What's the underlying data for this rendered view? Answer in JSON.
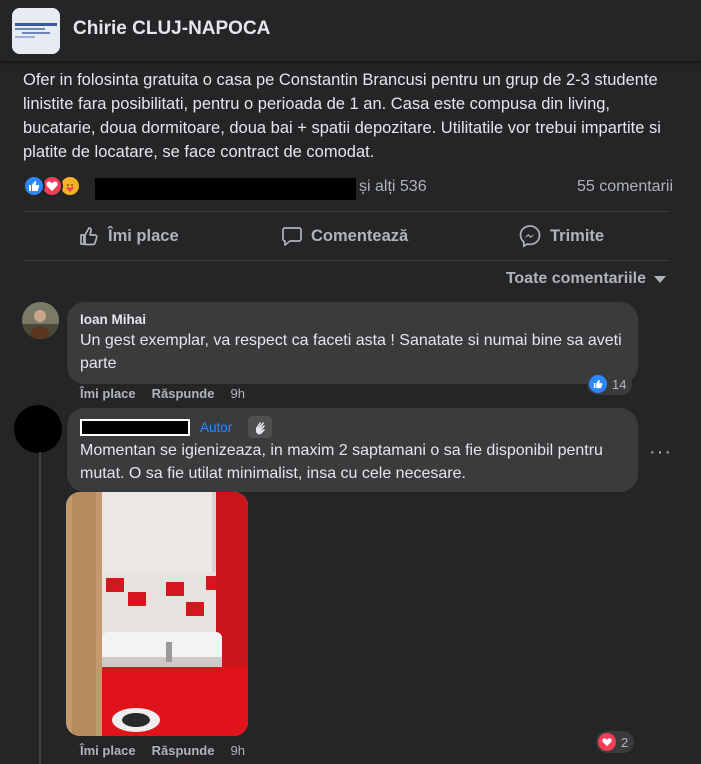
{
  "group": {
    "name": "Chirie CLUJ-NAPOCA"
  },
  "post": {
    "text": "Ofer in folosinta gratuita o casa pe Constantin Brancusi pentru un grup de 2-3 studente linistite fara posibilitati, pentru o perioada de 1 an. Casa este compusa din living, bucatarie, doua dormitoare, doua bai + spatii depozitare. Utilitatile vor trebui impartite si platite de locatare, se face contract de comodat.",
    "reactions": {
      "icons": [
        "like-icon",
        "love-icon",
        "care-icon"
      ],
      "others": "și alți 536",
      "comments": "55 comentarii"
    },
    "actions": {
      "like": "Îmi place",
      "comment": "Comentează",
      "share": "Trimite"
    }
  },
  "comments_sort": "Toate comentariile",
  "comments": [
    {
      "author": "Ioan Mihai",
      "text": "Un gest exemplar, va respect ca faceti asta ! Sanatate si numai bine sa aveti parte",
      "like": "Îmi place",
      "reply": "Răspunde",
      "time": "9h",
      "reaction_count": "14"
    },
    {
      "author_badge": "Autor",
      "text": "Momentan se igienizeaza, in maxim 2 saptamani o sa fie disponibil pentru mutat. O sa fie utilat minimalist, insa cu cele necesare.",
      "like": "Îmi place",
      "reply": "Răspunde",
      "time": "9h",
      "reaction_count": "2",
      "more": "···"
    }
  ],
  "colors": {
    "card": "#242526",
    "bubble": "#3a3b3c",
    "accent": "#2d88ff",
    "text": "#e4e6eb",
    "muted": "#b0b3b8"
  }
}
